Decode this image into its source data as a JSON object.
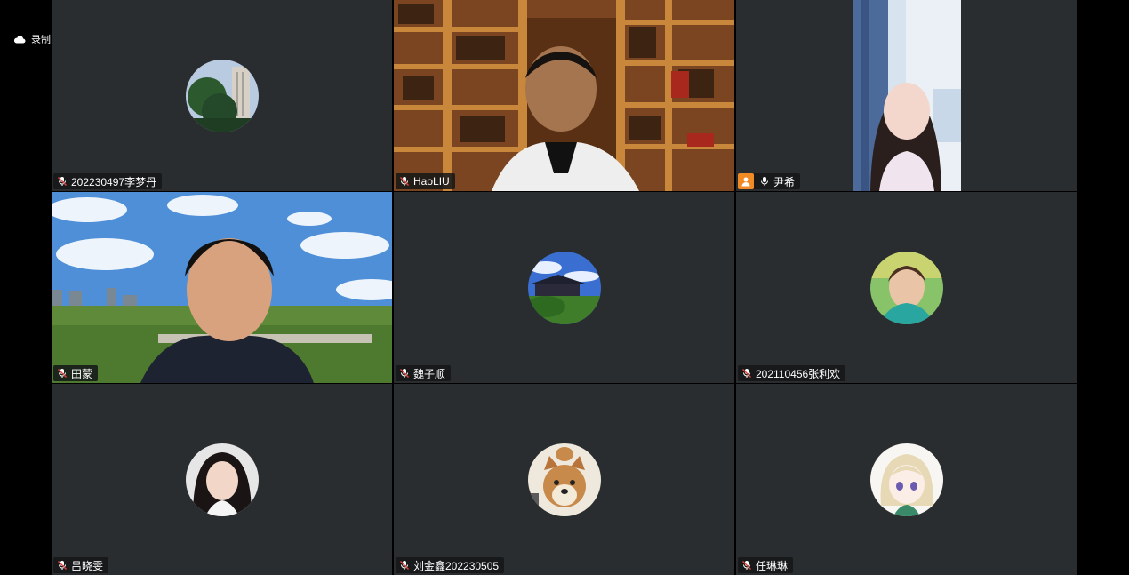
{
  "recording": {
    "label": "录制中",
    "icon": "cloud-icon"
  },
  "tiles": [
    {
      "name": "202230497李梦丹",
      "mic": "muted",
      "view": "avatar"
    },
    {
      "name": "HaoLIU",
      "mic": "muted",
      "view": "video"
    },
    {
      "name": "尹希",
      "mic": "on",
      "view": "video",
      "host_badge": true
    },
    {
      "name": "田蒙",
      "mic": "muted",
      "view": "video"
    },
    {
      "name": "魏子顺",
      "mic": "muted",
      "view": "avatar"
    },
    {
      "name": "202110456张利欢",
      "mic": "muted",
      "view": "avatar"
    },
    {
      "name": "吕晓雯",
      "mic": "muted",
      "view": "avatar"
    },
    {
      "name": "刘金鑫202230505",
      "mic": "muted",
      "view": "avatar"
    },
    {
      "name": "任琳琳",
      "mic": "muted",
      "view": "avatar"
    }
  ],
  "colors": {
    "tile_bg": "#2a2d30",
    "host_badge": "#f08a24",
    "mic_muted": "#e0443e"
  }
}
